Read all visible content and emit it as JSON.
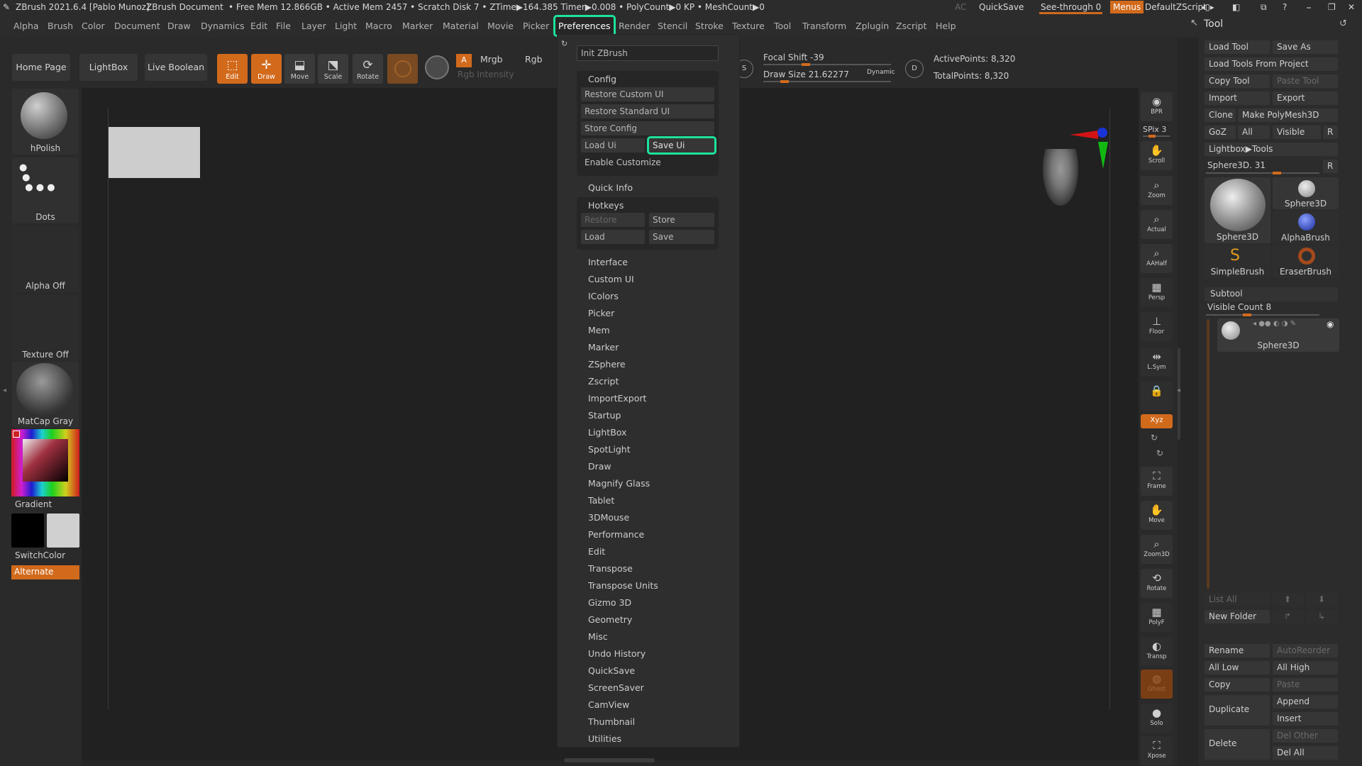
{
  "titlebar": {
    "app": "ZBrush 2021.6.4 [Pablo Munoz]",
    "doc": "ZBrush Document",
    "stats": "• Free Mem 12.866GB • Active Mem 2457 • Scratch Disk 7 • ZTime▶164.385 Timer▶0.008 • PolyCount▶0 KP • MeshCount▶0",
    "ac": "AC",
    "quicksave": "QuickSave",
    "see_through": "See-through  0",
    "menus": "Menus",
    "default_zscript": "DefaultZScript"
  },
  "menubar": [
    "Alpha",
    "Brush",
    "Color",
    "Document",
    "Draw",
    "Dynamics",
    "Edit",
    "File",
    "Layer",
    "Light",
    "Macro",
    "Marker",
    "Material",
    "Movie",
    "Picker",
    "Preferences",
    "Render",
    "Stencil",
    "Stroke",
    "Texture",
    "Tool",
    "Transform",
    "Zplugin",
    "Zscript",
    "Help"
  ],
  "toolbar": {
    "home": "Home Page",
    "lightbox": "LightBox",
    "liveboolean": "Live Boolean",
    "edit": "Edit",
    "draw": "Draw",
    "move": "Move",
    "scale": "Scale",
    "rotate": "Rotate",
    "a": "A",
    "mrgb": "Mrgb",
    "rgb": "Rgb",
    "rgb_intensity": "Rgb Intensity",
    "focal_shift": "Focal Shift -39",
    "draw_size": "Draw Size 21.62277",
    "dynamic": "Dynamic",
    "active_points": "ActivePoints: 8,320",
    "total_points": "TotalPoints: 8,320"
  },
  "leftshelf": {
    "brush": "hPolish",
    "stroke": "Dots",
    "alpha": "Alpha Off",
    "texture": "Texture Off",
    "material": "MatCap Gray",
    "gradient": "Gradient",
    "switchcolor": "SwitchColor",
    "alternate": "Alternate"
  },
  "rightshelf": [
    "BPR",
    "SPix 3",
    "Scroll",
    "Zoom",
    "Actual",
    "AAHalf",
    "Persp",
    "Floor",
    "L.Sym",
    "",
    "Xyz",
    "",
    "",
    "Frame",
    "Move",
    "Zoom3D",
    "Rotate",
    "PolyF",
    "Transp",
    "Ghost",
    "Solo",
    "Xpose"
  ],
  "preferences_menu": {
    "init": "Init ZBrush",
    "config": "Config",
    "restore_custom": "Restore Custom UI",
    "restore_standard": "Restore Standard UI",
    "store_config": "Store Config",
    "load_ui": "Load Ui",
    "save_ui": "Save Ui",
    "enable_customize": "Enable Customize",
    "quick_info": "Quick Info",
    "hotkeys": "Hotkeys",
    "hk_restore": "Restore",
    "hk_store": "Store",
    "hk_load": "Load",
    "hk_save": "Save",
    "items": [
      "Interface",
      "Custom UI",
      "IColors",
      "Picker",
      "Mem",
      "Marker",
      "ZSphere",
      "Zscript",
      "ImportExport",
      "Startup",
      "LightBox",
      "SpotLight",
      "Draw",
      "Magnify Glass",
      "Tablet",
      "3DMouse",
      "Performance",
      "Edit",
      "Transpose",
      "Transpose Units",
      "Gizmo 3D",
      "Geometry",
      "Misc",
      "Undo History",
      "QuickSave",
      "ScreenSaver",
      "CamView",
      "Thumbnail",
      "Utilities"
    ]
  },
  "tool_panel": {
    "title": "Tool",
    "load_tool": "Load Tool",
    "save_as": "Save As",
    "load_from_project": "Load Tools From Project",
    "copy_tool": "Copy Tool",
    "paste_tool": "Paste Tool",
    "import": "Import",
    "export": "Export",
    "clone": "Clone",
    "make_polymesh": "Make PolyMesh3D",
    "goz": "GoZ",
    "all": "All",
    "visible": "Visible",
    "r": "R",
    "lightbox_tools": "Lightbox▶Tools",
    "current_tool": "Sphere3D. 31",
    "thumbs": [
      "Sphere3D",
      "Sphere3D",
      "AlphaBrush",
      "SimpleBrush",
      "EraserBrush"
    ],
    "subtool": "Subtool",
    "visible_count": "Visible Count 8",
    "subtool_item": "Sphere3D",
    "list_all": "List All",
    "new_folder": "New Folder",
    "rename": "Rename",
    "autoreorder": "AutoReorder",
    "all_low": "All Low",
    "all_high": "All High",
    "copy": "Copy",
    "paste": "Paste",
    "append": "Append",
    "duplicate": "Duplicate",
    "insert": "Insert",
    "del_other": "Del Other",
    "delete": "Delete",
    "del_all": "Del All"
  },
  "colors": {
    "accent": "#d26a1c",
    "highlight": "#1de29a"
  }
}
